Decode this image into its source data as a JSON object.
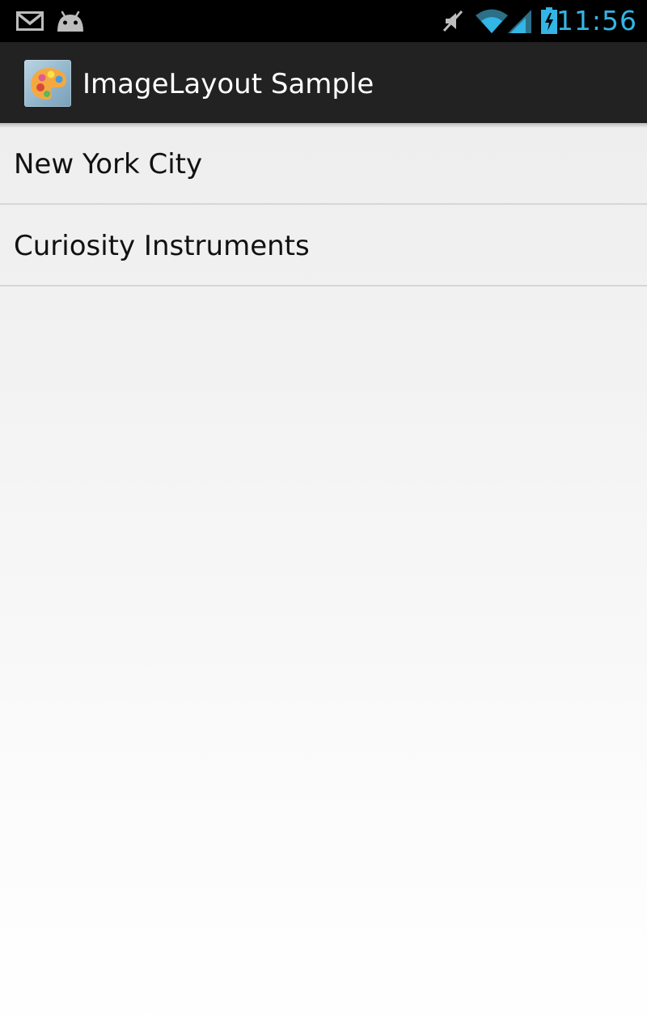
{
  "status_bar": {
    "time": "11:56",
    "time_color": "#33b5e5",
    "icons": [
      "gmail-icon",
      "android-icon",
      "mute-icon",
      "wifi-icon",
      "signal-icon",
      "battery-charging-icon"
    ]
  },
  "action_bar": {
    "logo_icon": "palette-icon",
    "title": "ImageLayout Sample",
    "background": "#222222"
  },
  "list": {
    "items": [
      {
        "label": "New York City"
      },
      {
        "label": "Curiosity Instruments"
      }
    ]
  }
}
